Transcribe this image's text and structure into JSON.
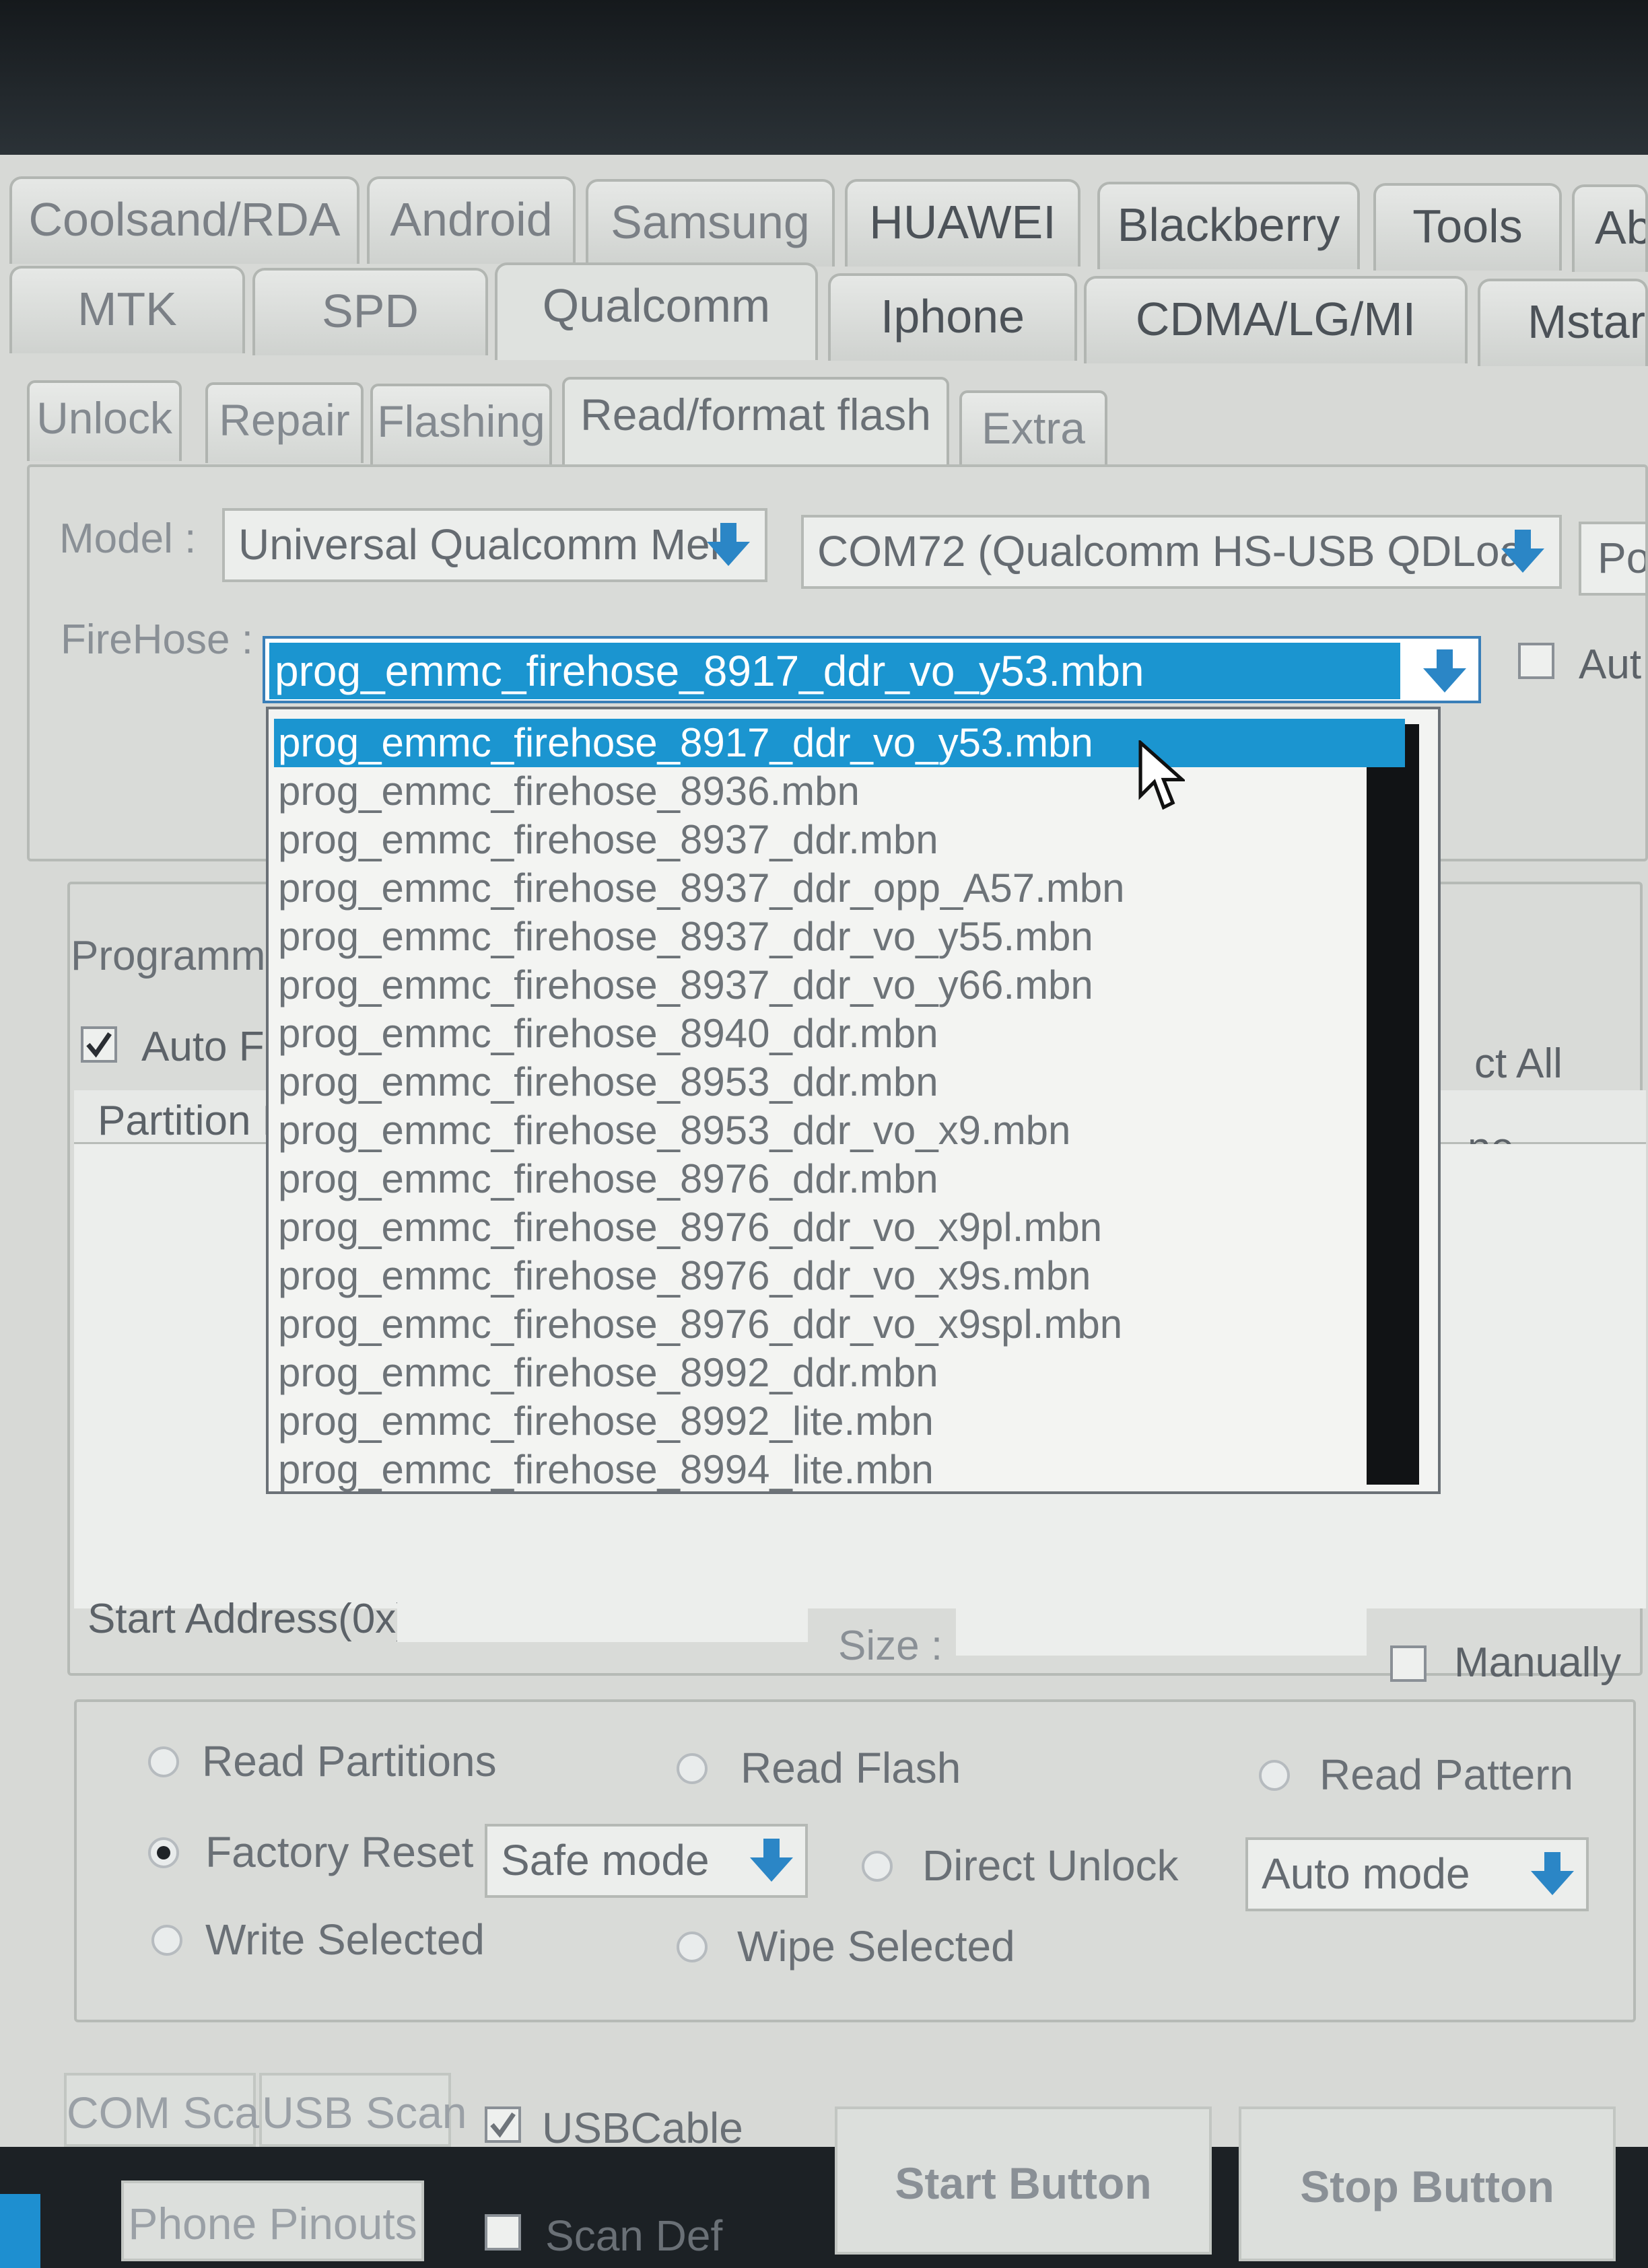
{
  "brand_tabs_row1": [
    "Coolsand/RDA",
    "Android",
    "Samsung",
    "HUAWEI",
    "Blackberry",
    "Tools",
    "Ab"
  ],
  "brand_tabs_row2": [
    "MTK",
    "SPD",
    "Qualcomm",
    "Iphone",
    "CDMA/LG/MI",
    "Mstar/"
  ],
  "sub_tabs": [
    "Unlock",
    "Repair",
    "Flashing",
    "Read/format flash",
    "Extra"
  ],
  "model": {
    "label": "Model :",
    "value": "Universal Qualcomm Mel",
    "port_value": "COM72 (Qualcomm HS-USB QDLoa",
    "port_button": "Po"
  },
  "firehose": {
    "label": "FireHose :",
    "value": "prog_emmc_firehose_8917_ddr_vo_y53.mbn",
    "auto_label": "Aut",
    "options": [
      "prog_emmc_firehose_8917_ddr_vo_y53.mbn",
      "prog_emmc_firehose_8936.mbn",
      "prog_emmc_firehose_8937_ddr.mbn",
      "prog_emmc_firehose_8937_ddr_opp_A57.mbn",
      "prog_emmc_firehose_8937_ddr_vo_y55.mbn",
      "prog_emmc_firehose_8937_ddr_vo_y66.mbn",
      "prog_emmc_firehose_8940_ddr.mbn",
      "prog_emmc_firehose_8953_ddr.mbn",
      "prog_emmc_firehose_8953_ddr_vo_x9.mbn",
      "prog_emmc_firehose_8976_ddr.mbn",
      "prog_emmc_firehose_8976_ddr_vo_x9pl.mbn",
      "prog_emmc_firehose_8976_ddr_vo_x9s.mbn",
      "prog_emmc_firehose_8976_ddr_vo_x9spl.mbn",
      "prog_emmc_firehose_8992_ddr.mbn",
      "prog_emmc_firehose_8992_lite.mbn",
      "prog_emmc_firehose_8994_lite.mbn"
    ]
  },
  "partition_area": {
    "programmer_label": "Programme",
    "auto_label": "Auto F",
    "select_all": "ct All",
    "col_partition": "Partition N",
    "col_name": "ne",
    "start_address": "Start Address(0x)",
    "size_label": "Size :",
    "manually": "Manually"
  },
  "operations": {
    "read_partitions": "Read Partitions",
    "read_flash": "Read Flash",
    "read_pattern": "Read Pattern",
    "factory_reset": "Factory Reset",
    "safe_mode": "Safe mode",
    "direct_unlock": "Direct Unlock",
    "auto_mode": "Auto mode",
    "write_selected": "Write Selected",
    "wipe_selected": "Wipe Selected"
  },
  "bottom": {
    "com_scan": "COM Scan",
    "usb_scan": "USB Scan",
    "usb_cable": "USBCable",
    "phone_pinouts": "Phone Pinouts",
    "scan_def": "Scan Def",
    "start": "Start Button",
    "stop": "Stop Button"
  },
  "colors": {
    "selection": "#1b95d0",
    "window": "#d7d9d6",
    "frame": "#1c2125"
  }
}
